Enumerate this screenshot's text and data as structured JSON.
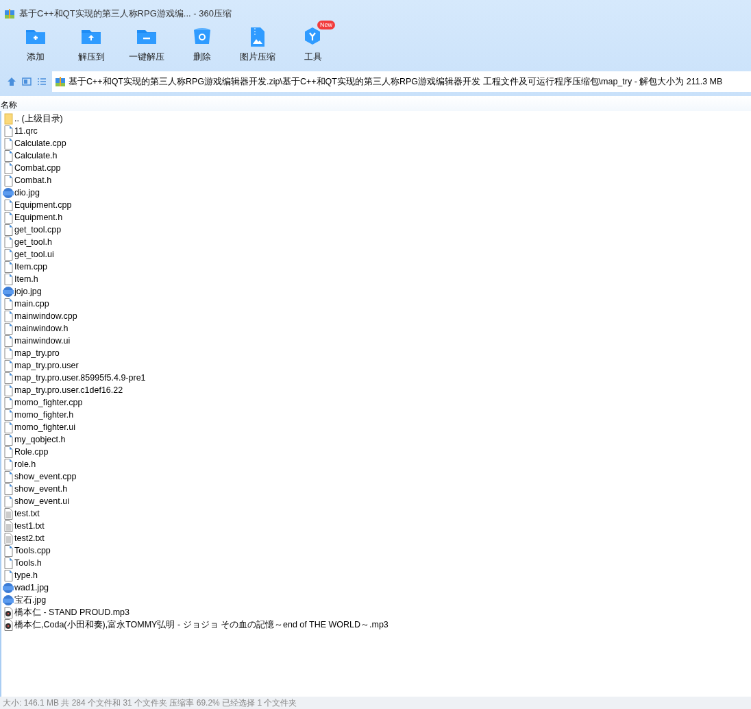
{
  "window": {
    "title": "基于C++和QT实现的第三人称RPG游戏编... - 360压缩"
  },
  "toolbar": [
    {
      "label": "添加",
      "kind": "add"
    },
    {
      "label": "解压到",
      "kind": "extract"
    },
    {
      "label": "一键解压",
      "kind": "oneclick"
    },
    {
      "label": "删除",
      "kind": "delete"
    },
    {
      "label": "图片压缩",
      "kind": "image"
    },
    {
      "label": "工具",
      "kind": "tools",
      "badge": "New"
    }
  ],
  "address": {
    "path": "基于C++和QT实现的第三人称RPG游戏编辑器开发.zip\\基于C++和QT实现的第三人称RPG游戏编辑器开发 工程文件及可运行程序压缩包\\map_try - 解包大小为 211.3 MB"
  },
  "list": {
    "column": "名称",
    "rows": [
      {
        "name": ".. (上级目录)",
        "kind": "folder"
      },
      {
        "name": "11.qrc",
        "kind": "file"
      },
      {
        "name": "Calculate.cpp",
        "kind": "file"
      },
      {
        "name": "Calculate.h",
        "kind": "file"
      },
      {
        "name": "Combat.cpp",
        "kind": "file"
      },
      {
        "name": "Combat.h",
        "kind": "file"
      },
      {
        "name": "dio.jpg",
        "kind": "jpg"
      },
      {
        "name": "Equipment.cpp",
        "kind": "file"
      },
      {
        "name": "Equipment.h",
        "kind": "file"
      },
      {
        "name": "get_tool.cpp",
        "kind": "file"
      },
      {
        "name": "get_tool.h",
        "kind": "file"
      },
      {
        "name": "get_tool.ui",
        "kind": "file"
      },
      {
        "name": "Item.cpp",
        "kind": "file"
      },
      {
        "name": "Item.h",
        "kind": "file"
      },
      {
        "name": "jojo.jpg",
        "kind": "jpg"
      },
      {
        "name": "main.cpp",
        "kind": "file"
      },
      {
        "name": "mainwindow.cpp",
        "kind": "file"
      },
      {
        "name": "mainwindow.h",
        "kind": "file"
      },
      {
        "name": "mainwindow.ui",
        "kind": "file"
      },
      {
        "name": "map_try.pro",
        "kind": "file"
      },
      {
        "name": "map_try.pro.user",
        "kind": "file"
      },
      {
        "name": "map_try.pro.user.85995f5.4.9-pre1",
        "kind": "file"
      },
      {
        "name": "map_try.pro.user.c1def16.22",
        "kind": "file"
      },
      {
        "name": "momo_fighter.cpp",
        "kind": "file"
      },
      {
        "name": "momo_fighter.h",
        "kind": "file"
      },
      {
        "name": "momo_fighter.ui",
        "kind": "file"
      },
      {
        "name": "my_qobject.h",
        "kind": "file"
      },
      {
        "name": "Role.cpp",
        "kind": "file"
      },
      {
        "name": "role.h",
        "kind": "file"
      },
      {
        "name": "show_event.cpp",
        "kind": "file"
      },
      {
        "name": "show_event.h",
        "kind": "file"
      },
      {
        "name": "show_event.ui",
        "kind": "file"
      },
      {
        "name": "test.txt",
        "kind": "txt"
      },
      {
        "name": "test1.txt",
        "kind": "txt"
      },
      {
        "name": "test2.txt",
        "kind": "txt"
      },
      {
        "name": "Tools.cpp",
        "kind": "file"
      },
      {
        "name": "Tools.h",
        "kind": "file"
      },
      {
        "name": "type.h",
        "kind": "file"
      },
      {
        "name": "wad1.jpg",
        "kind": "jpg"
      },
      {
        "name": "宝石.jpg",
        "kind": "jpg"
      },
      {
        "name": "橋本仁 - STAND PROUD.mp3",
        "kind": "mp3"
      },
      {
        "name": "橋本仁,Coda(小田和奏),富永TOMMY弘明 - ジョジョ その血の記憶～end of THE WORLD～.mp3",
        "kind": "mp3"
      }
    ]
  },
  "status_bar": "大小: 146.1 MB 共 284 个文件和 31 个文件夹 压缩率 69.2% 已经选择 1 个文件夹"
}
